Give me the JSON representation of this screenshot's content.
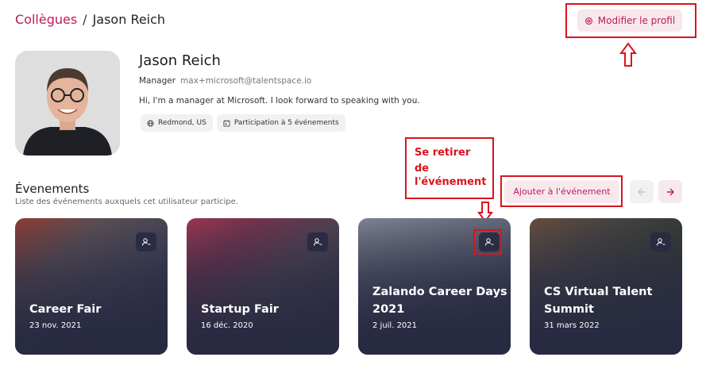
{
  "breadcrumb": {
    "parent": "Collègues",
    "separator": "/",
    "current": "Jason Reich"
  },
  "header": {
    "edit_profile_label": "Modifier le profil"
  },
  "profile": {
    "name": "Jason Reich",
    "role": "Manager",
    "email": "max+microsoft@talentspace.io",
    "bio": "Hi, I'm a manager at Microsoft. I look forward to speaking with you.",
    "chips": [
      {
        "icon": "globe-icon",
        "label": "Redmond, US"
      },
      {
        "icon": "calendar-icon",
        "label": "Participation à 5 événements"
      }
    ]
  },
  "events_section": {
    "title": "Évenements",
    "subtitle": "Liste des événements auxquels cet utilisateur participe.",
    "add_label": "Ajouter à l'événement",
    "prev_icon": "arrow-left-icon",
    "next_icon": "arrow-right-icon"
  },
  "annotation": {
    "leave_event_line1": "Se retirer",
    "leave_event_line2": "de",
    "leave_event_line3": "l'événement"
  },
  "events": [
    {
      "title": "Career Fair",
      "title2": "",
      "date": "23 nov. 2021"
    },
    {
      "title": "Startup Fair",
      "title2": "",
      "date": "16 déc. 2020"
    },
    {
      "title": "Zalando Career Days",
      "title2": "2021",
      "date": "2 juil. 2021"
    },
    {
      "title": "CS Virtual Talent",
      "title2": "Summit",
      "date": "31 mars 2022"
    }
  ],
  "colors": {
    "accent": "#c2185b",
    "accent_bg": "#f7e8ec",
    "annotation": "#d9141e",
    "card_overlay": "#282a42"
  }
}
